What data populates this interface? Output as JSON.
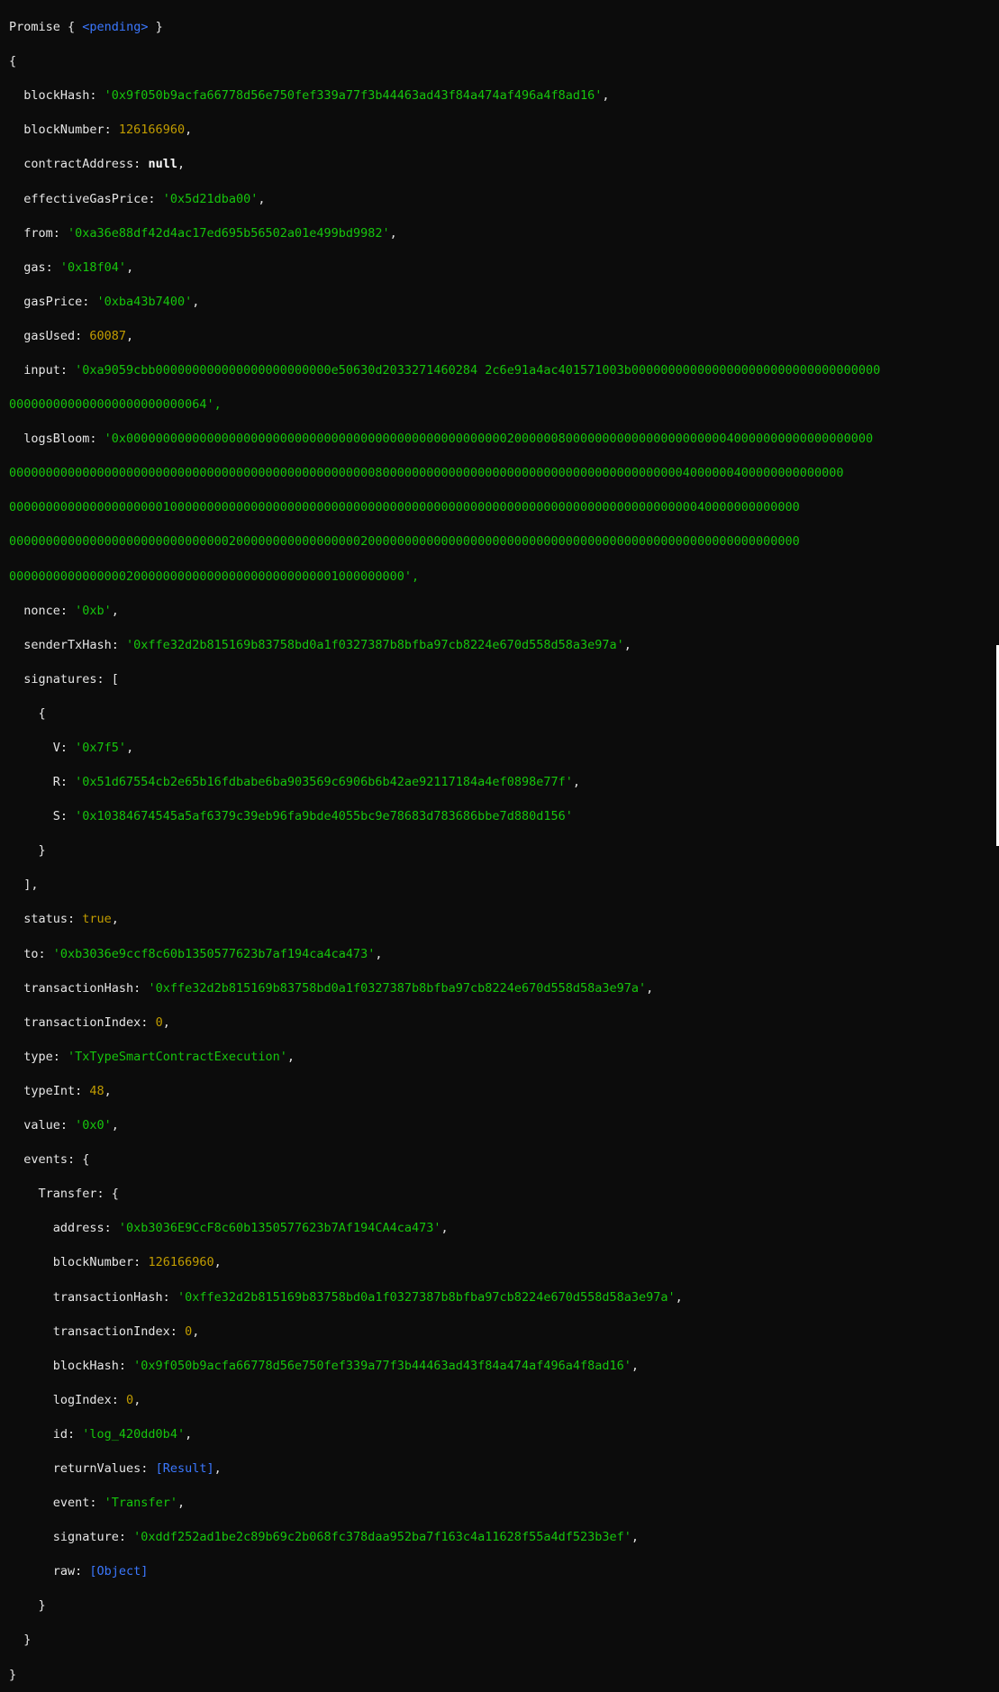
{
  "promise": {
    "label": "Promise",
    "state": "<pending>"
  },
  "receipt": {
    "blockHash": "'0x9f050b9acfa66778d56e750fef339a77f3b44463ad43f84a474af496a4f8ad16'",
    "blockNumber": "126166960",
    "contractAddress": "null",
    "effectiveGasPrice": "'0x5d21dba00'",
    "from": "'0xa36e88df42d4ac17ed695b56502a01e499bd9982'",
    "gas": "'0x18f04'",
    "gasPrice": "'0xba43b7400'",
    "gasUsed": "60087",
    "input_lines": [
      "'0xa9059cbb000000000000000000000000e50630d2033271460284 2c6e91a4ac401571003b0000000000000000000000000000000000",
      "000000000000000000000000064',"
    ],
    "logsBloom_lines": [
      "'0x000000000000000000000000000000000000000000000000000020000008000000000000000000000040000000000000000000",
      "000000000000000000000000000000000000000000000000008000000000000000000000000000000000000000004000000400000000000000",
      "000000000000000000000100000000000000000000000000000000000000000000000000000000000000000000000040000000000000",
      "000000000000000000000000000000200000000000000000200000000000000000000000000000000000000000000000000000000000",
      "000000000000000020000000000000000000000000001000000000',"
    ],
    "nonce": "'0xb'",
    "senderTxHash": "'0xffe32d2b815169b83758bd0a1f0327387b8bfba97cb8224e670d558d58a3e97a'",
    "signatures": [
      {
        "V": "'0x7f5'",
        "R": "'0x51d67554cb2e65b16fdbabe6ba903569c6906b6b42ae92117184a4ef0898e77f'",
        "S": "'0x10384674545a5af6379c39eb96fa9bde4055bc9e78683d783686bbe7d880d156'"
      }
    ],
    "status": "true",
    "to": "'0xb3036e9ccf8c60b1350577623b7af194ca4ca473'",
    "transactionHash": "'0xffe32d2b815169b83758bd0a1f0327387b8bfba97cb8224e670d558d58a3e97a'",
    "transactionIndex": "0",
    "type": "'TxTypeSmartContractExecution'",
    "typeInt": "48",
    "value": "'0x0'",
    "events": {
      "Transfer": {
        "address": "'0xb3036E9CcF8c60b1350577623b7Af194CA4ca473'",
        "blockNumber": "126166960",
        "transactionHash": "'0xffe32d2b815169b83758bd0a1f0327387b8bfba97cb8224e670d558d58a3e97a'",
        "transactionIndex": "0",
        "blockHash": "'0x9f050b9acfa66778d56e750fef339a77f3b44463ad43f84a474af496a4f8ad16'",
        "logIndex": "0",
        "id": "'log_420dd0b4'",
        "returnValues": "[Result]",
        "event": "'Transfer'",
        "signature": "'0xddf252ad1be2c89b69c2b068fc378daa952ba7f163c4a11628f55a4df523b3ef'",
        "raw": "[Object]"
      }
    }
  },
  "colors": {
    "background": "#0c0c0c",
    "key": "#e6e6e6",
    "string": "#16c60c",
    "number": "#c19c00",
    "special": "#3b78ff"
  }
}
